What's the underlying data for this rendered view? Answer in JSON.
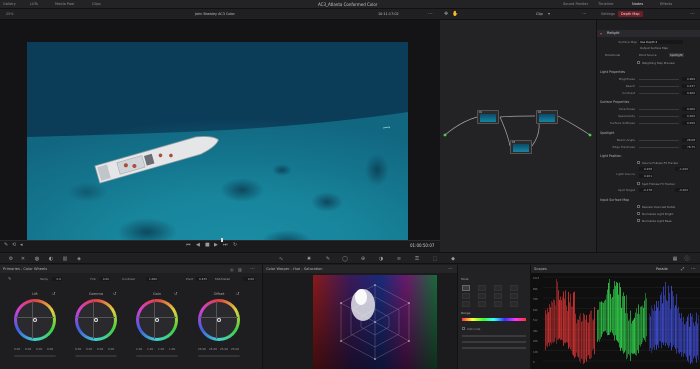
{
  "menu": {
    "items": [
      "Gallery",
      "LUTs",
      "Media Pool",
      "Clips"
    ],
    "project_title": "AC3_Atlanta Conformed Color",
    "right_items": [
      "Sound Painter",
      "Timeline",
      "Nodes",
      "Effects"
    ]
  },
  "viewer": {
    "zoom": "25%",
    "clip_name": "John Brawley AC3 Color",
    "timecode_top": "10:11:17:02",
    "timecode": "01:00:50:07"
  },
  "nodes": {
    "mode": "Clip",
    "node_labels": [
      "01",
      "02",
      "03",
      "04"
    ]
  },
  "inspector": {
    "tabs": [
      "Settings",
      "Depth Map"
    ],
    "active_tab": "Depth Map",
    "title": "Relight",
    "surface_map_label": "Surface Map",
    "surface_map_value": "Use Depth 2",
    "output_surface_map": "Output Surface Map",
    "directional_label": "Directional",
    "point_source_label": "Point Source",
    "spotlight_label": "Spotlight",
    "weighting_map_preview": "Weighting Map Preview",
    "sections": {
      "light_properties": "Light Properties",
      "surface_properties": "Surface Properties",
      "spotlight": "Spotlight",
      "light_position": "Light Position",
      "input_surface_map": "Input Surface Map"
    },
    "light_properties": [
      {
        "label": "Brightness",
        "value": "0.969"
      },
      {
        "label": "Reach",
        "value": "0.237"
      },
      {
        "label": "Contrast",
        "value": "0.400"
      }
    ],
    "surface_properties": [
      {
        "label": "Directness",
        "value": "0.000"
      },
      {
        "label": "Specularity",
        "value": "0.200"
      },
      {
        "label": "Surface Softness",
        "value": "0.250"
      }
    ],
    "spotlight": [
      {
        "label": "Beam Angle",
        "value": "28.08"
      },
      {
        "label": "Edge Hardness",
        "value": "78.75"
      }
    ],
    "light_position": {
      "source_follows_fx_tracker": "Source Follows FX Tracker",
      "light_source_label": "Light Source",
      "light_source_x": "0.258",
      "light_source_y": "0.201",
      "light_source_z": "-1.020",
      "spot_follows_fx_tracker": "Spot Follows FX Tracker",
      "spot_target_label": "Spot Target",
      "spot_target_x": "-0.178",
      "spot_target_y": "-0.202"
    },
    "input_surface_map": [
      "Rescale Overcast Detail",
      "Normalize Light Bright",
      "Normalize Light Base"
    ]
  },
  "color_wheels": {
    "title": "Primaries - Color Wheels",
    "temp_label": "Temp",
    "temp_value": "0.0",
    "tint_label": "Tint",
    "tint_value": "0.00",
    "contrast_label": "Contrast",
    "contrast_value": "1.000",
    "pivot_label": "Pivot",
    "pivot_value": "0.435",
    "mid_detail_label": "Mid/Detail",
    "mid_detail_value": "0.00",
    "wheels": [
      {
        "name": "Lift",
        "values": [
          "0.00",
          "0.00",
          "0.00",
          "0.00"
        ]
      },
      {
        "name": "Gamma",
        "values": [
          "0.00",
          "0.00",
          "0.00",
          "0.00"
        ]
      },
      {
        "name": "Gain",
        "values": [
          "1.00",
          "1.00",
          "1.00",
          "1.00"
        ]
      },
      {
        "name": "Offset",
        "values": [
          "25.00",
          "25.00",
          "25.00",
          "25.00"
        ]
      }
    ]
  },
  "warper": {
    "title": "Color Warper - Hue - Saturation"
  },
  "warper_tools": {
    "tool_label": "Tools",
    "range_label": "Range",
    "add_node_label": "Add node"
  },
  "scopes": {
    "title": "Scopes",
    "mode": "Parade",
    "scale": [
      "1023",
      "896",
      "768",
      "640",
      "512",
      "384",
      "256",
      "128",
      "0"
    ],
    "colors": {
      "red": "#ff3a3a",
      "green": "#3aff5a",
      "blue": "#4a5aff"
    }
  }
}
